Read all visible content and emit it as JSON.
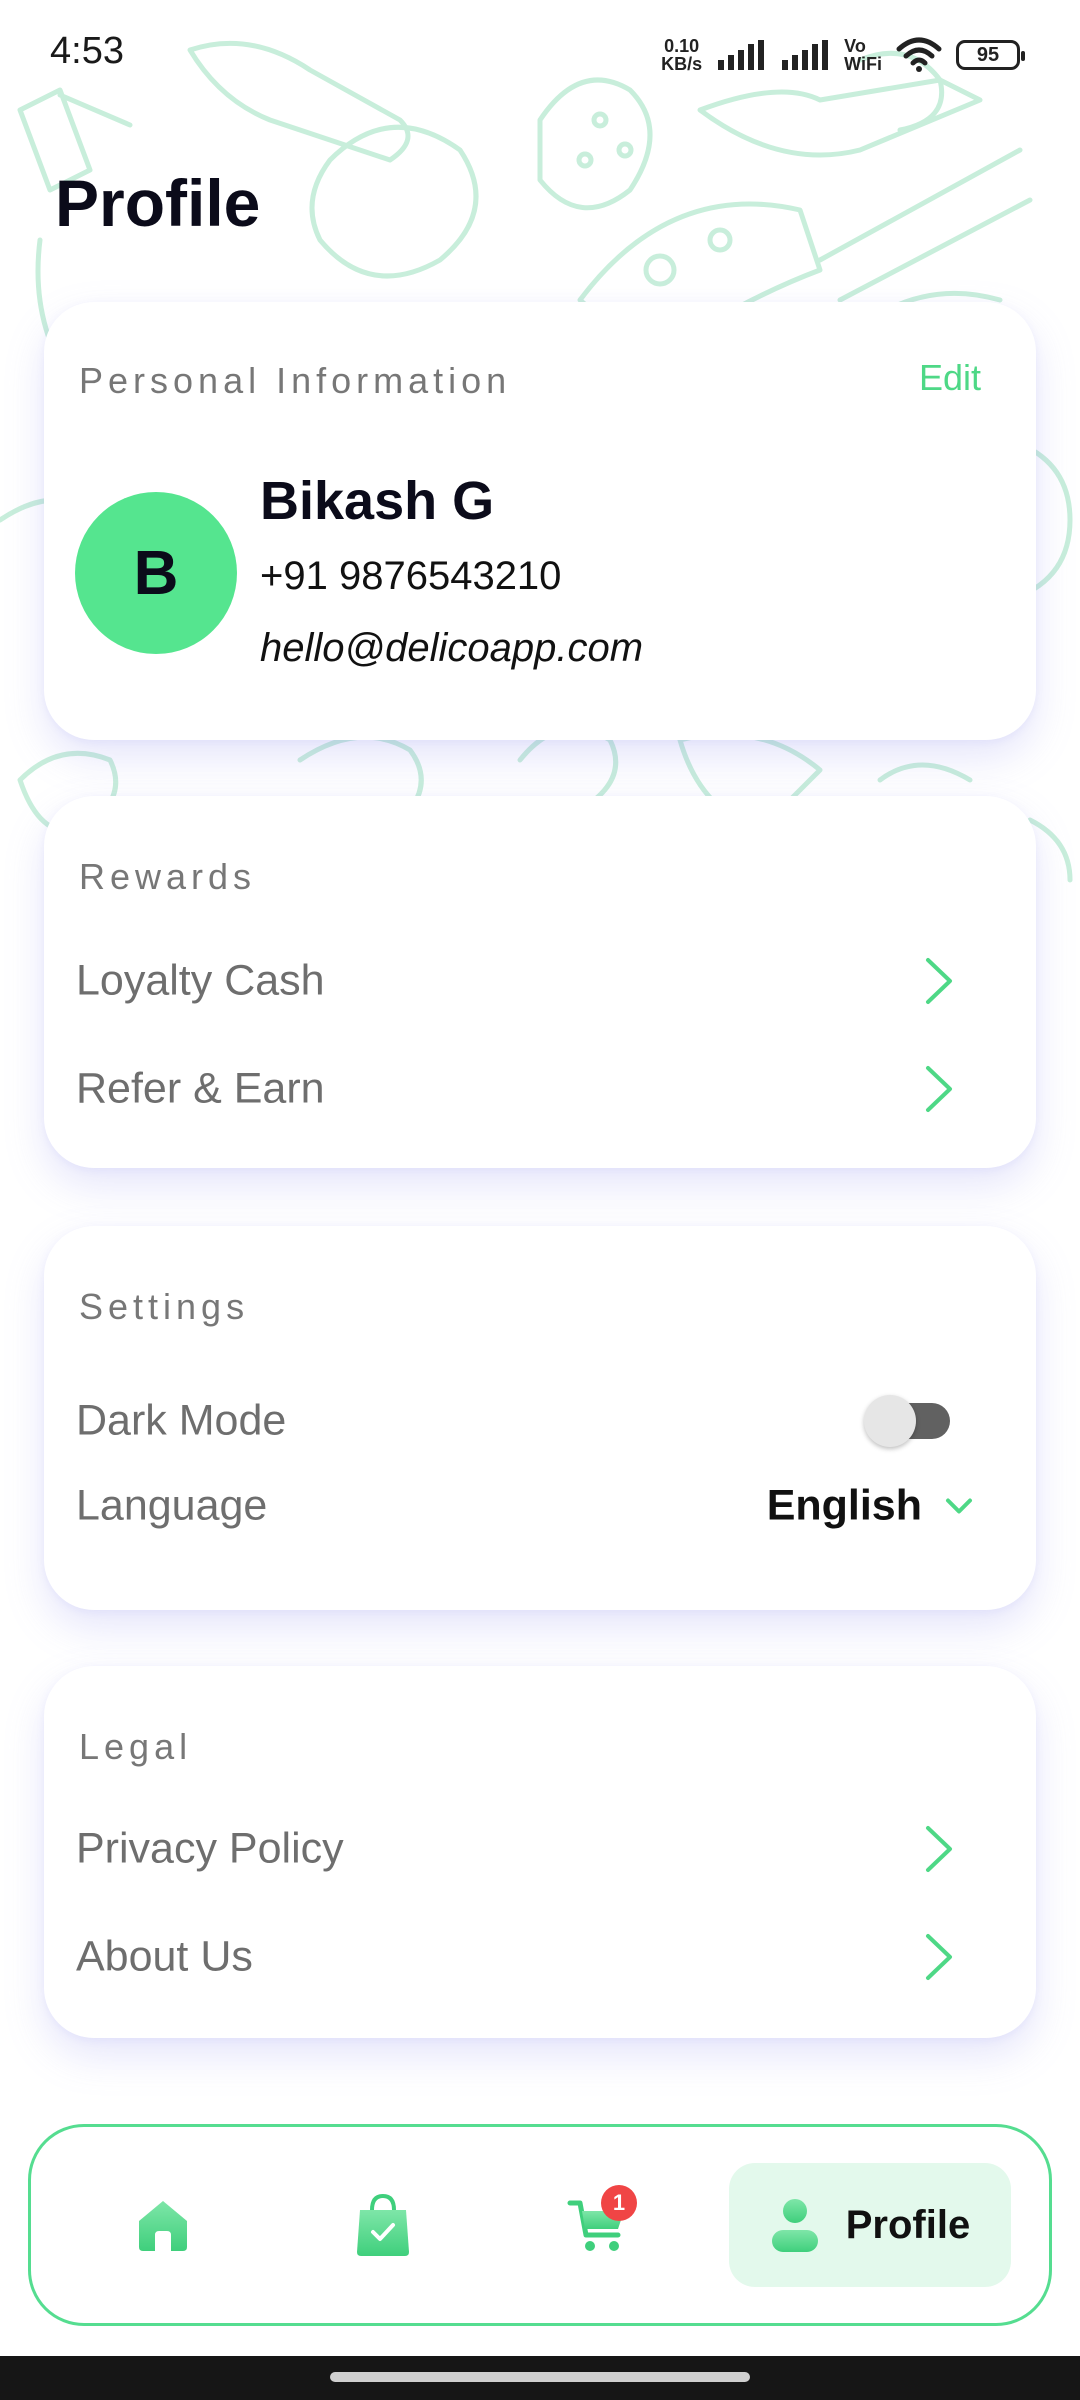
{
  "status_bar": {
    "time": "4:53",
    "net_speed_value": "0.10",
    "net_speed_unit": "KB/s",
    "vowifi_top": "Vo",
    "vowifi_bottom": "WiFi",
    "battery": "95"
  },
  "page": {
    "title": "Profile"
  },
  "personal_info": {
    "heading": "Personal Information",
    "edit_label": "Edit",
    "avatar_initial": "B",
    "name": "Bikash G",
    "phone": "+91 9876543210",
    "email": "hello@delicoapp.com"
  },
  "rewards": {
    "heading": "Rewards",
    "items": [
      {
        "label": "Loyalty Cash"
      },
      {
        "label": "Refer & Earn"
      }
    ]
  },
  "settings": {
    "heading": "Settings",
    "dark_mode_label": "Dark Mode",
    "dark_mode_on": false,
    "language_label": "Language",
    "language_value": "English"
  },
  "legal": {
    "heading": "Legal",
    "items": [
      {
        "label": "Privacy Policy"
      },
      {
        "label": "About Us"
      }
    ]
  },
  "bottom_nav": {
    "items": [
      {
        "icon": "home-icon"
      },
      {
        "icon": "shopping-bag-icon"
      },
      {
        "icon": "cart-icon",
        "badge": "1"
      },
      {
        "icon": "profile-icon",
        "label": "Profile",
        "active": true
      }
    ]
  },
  "colors": {
    "accent": "#55e58f",
    "accent_text": "#4ed886",
    "badge": "#f04545",
    "doodle": "#c8eedb"
  }
}
